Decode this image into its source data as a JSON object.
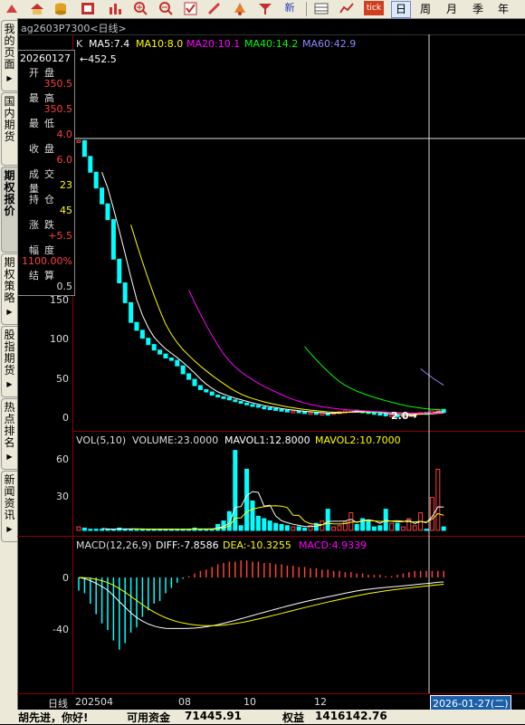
{
  "toolbar": {
    "period_tabs": [
      "日",
      "周",
      "月",
      "季",
      "年"
    ],
    "active_period": "日",
    "new_label": "新",
    "tick_label": "tick"
  },
  "left_tabs": [
    "我的页面",
    "国内期货",
    "期权报价",
    "期权策略",
    "股指期货",
    "热点排名",
    "新闻资讯"
  ],
  "active_left_tab": "期权报价",
  "title": "ag2603P7300<日线>",
  "price_panel": {
    "indicator_k": "K",
    "ma": [
      {
        "label": "MA5:7.4",
        "color": "#ffffff"
      },
      {
        "label": "MA10:8.0",
        "color": "#ffff00"
      },
      {
        "label": "MA20:10.1",
        "color": "#ff00ff"
      },
      {
        "label": "MA40:14.2",
        "color": "#00ff00"
      },
      {
        "label": "MA60:42.9",
        "color": "#8888ff"
      }
    ],
    "high_label": "452.5",
    "low_label": "2.0",
    "y_ticks": [
      "150",
      "100",
      "50",
      "0"
    ]
  },
  "info_box": {
    "date": "20260127",
    "rows": [
      {
        "label": "开盘",
        "value": "350.5",
        "color": "#ff4040"
      },
      {
        "label": "最高",
        "value": "350.5",
        "color": "#ff4040"
      },
      {
        "label": "最低",
        "value": "4.0",
        "color": "#ff4040"
      },
      {
        "label": "收盘",
        "value": "6.0",
        "color": "#ff4040"
      },
      {
        "label": "成交量",
        "value": "23",
        "color": "#ffff00"
      },
      {
        "label": "持仓",
        "value": "45",
        "color": "#ffff00"
      },
      {
        "label": "涨跌",
        "value": "+5.5",
        "color": "#ff4040"
      },
      {
        "label": "幅度",
        "value": "1100.00%",
        "color": "#ff4040"
      },
      {
        "label": "结算",
        "value": "0.5",
        "color": "#dddddd"
      }
    ]
  },
  "volume_panel": {
    "title": "VOL(5,10)",
    "volume": "VOLUME:23.0000",
    "mavol1": "MAVOL1:12.8000",
    "mavol2": "MAVOL2:10.7000",
    "y_ticks": [
      "60",
      "30"
    ]
  },
  "macd_panel": {
    "title": "MACD(12,26,9)",
    "diff": "DIFF:-7.8586",
    "dea": "DEA:-10.3255",
    "macd": "MACD:4.9339",
    "y_ticks": [
      "0",
      "-40"
    ]
  },
  "date_axis": {
    "period_label": "日线",
    "labels": [
      "202504",
      "08",
      "10",
      "12"
    ],
    "cursor_date": "2026-01-27(二)"
  },
  "status_bar": {
    "greeting": "胡先进，你好!",
    "funds_label": "可用资金",
    "funds_value": "71445.91",
    "equity_label": "权益",
    "equity_value": "1416142.76"
  },
  "colors": {
    "up": "#ff4040",
    "down": "#00ffff",
    "axis": "#8b0000",
    "cursor": "#ffffff"
  },
  "chart_data": {
    "type": "candlestick",
    "days": 64,
    "close": [
      350,
      330,
      310,
      290,
      270,
      250,
      200,
      170,
      145,
      120,
      110,
      100,
      92,
      85,
      80,
      75,
      72,
      65,
      55,
      48,
      40,
      35,
      32,
      28,
      26,
      25,
      22,
      20,
      18,
      16,
      15,
      13,
      12,
      11,
      10,
      9,
      8,
      8,
      7,
      6,
      6,
      5,
      5,
      4,
      6,
      7,
      8,
      9,
      8,
      7,
      6,
      5,
      4,
      3,
      3,
      2,
      3,
      4,
      5,
      6,
      5,
      8,
      10,
      6
    ],
    "volume": [
      3,
      2,
      1,
      1,
      1,
      1,
      1,
      2,
      1,
      1,
      1,
      1,
      1,
      1,
      1,
      1,
      1,
      1,
      1,
      1,
      2,
      1,
      1,
      1,
      5,
      8,
      16,
      68,
      4,
      52,
      25,
      12,
      10,
      8,
      6,
      5,
      4,
      3,
      3,
      2,
      4,
      6,
      8,
      18,
      3,
      4,
      7,
      15,
      5,
      10,
      8,
      3,
      4,
      18,
      6,
      6,
      3,
      10,
      4,
      15,
      1,
      28,
      52,
      3
    ],
    "macd_hist": [
      -10,
      -12,
      -20,
      -28,
      -35,
      -40,
      -48,
      -55,
      -50,
      -42,
      -38,
      -30,
      -25,
      -20,
      -18,
      -12,
      -8,
      -4,
      -1,
      1,
      3,
      5,
      6,
      8,
      10,
      11,
      12,
      12,
      13,
      13,
      12,
      12,
      11,
      11,
      10,
      10,
      9,
      9,
      8,
      8,
      7,
      7,
      6,
      6,
      5,
      5,
      4,
      4,
      3,
      3,
      2,
      2,
      2,
      1,
      1,
      2,
      3,
      4,
      5,
      5,
      5,
      5,
      5,
      5
    ]
  }
}
